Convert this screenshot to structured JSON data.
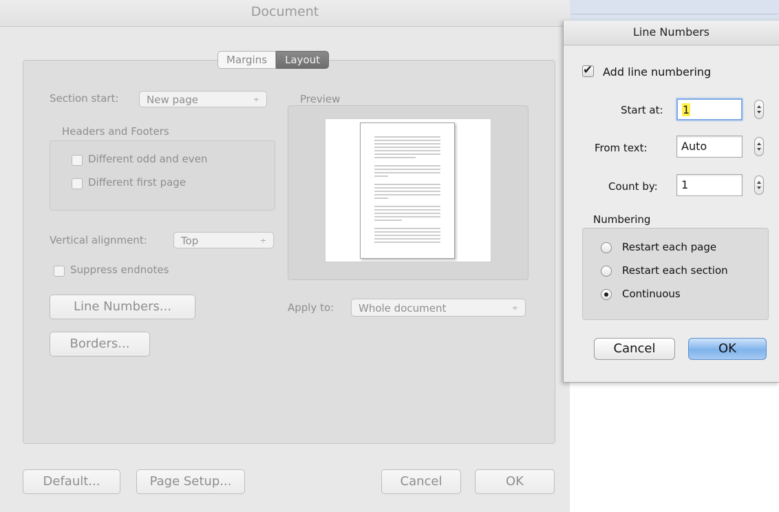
{
  "document_dialog": {
    "title": "Document",
    "tabs": [
      "Margins",
      "Layout"
    ],
    "section_start_label": "Section start:",
    "section_start_value": "New page",
    "headers_footers_label": "Headers and Footers",
    "diff_odd_even": "Different odd and even",
    "diff_first_page": "Different first page",
    "vertical_alignment_label": "Vertical alignment:",
    "vertical_alignment_value": "Top",
    "suppress_endnotes": "Suppress endnotes",
    "line_numbers_button": "Line Numbers...",
    "borders_button": "Borders...",
    "preview_label": "Preview",
    "apply_to_label": "Apply to:",
    "apply_to_value": "Whole document",
    "default_button": "Default...",
    "page_setup_button": "Page Setup...",
    "cancel_button": "Cancel",
    "ok_button": "OK",
    "popup_arrow": "÷"
  },
  "line_numbers_dialog": {
    "title": "Line Numbers",
    "add_line_numbering": "Add line numbering",
    "add_line_numbering_checked": true,
    "start_at_label": "Start at:",
    "start_at_value": "1",
    "from_text_label": "From text:",
    "from_text_value": "Auto",
    "count_by_label": "Count by:",
    "count_by_value": "1",
    "numbering_label": "Numbering",
    "options": [
      "Restart each page",
      "Restart each section",
      "Continuous"
    ],
    "selected_option": "Continuous",
    "cancel_button": "Cancel",
    "ok_button": "OK"
  },
  "colors": {
    "ok_accent": "#7fb3ec",
    "focus_ring": "#7fa9e4",
    "field_highlight": "#fff14a"
  }
}
